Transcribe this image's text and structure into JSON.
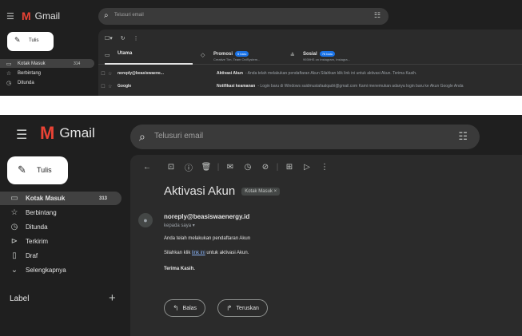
{
  "app": {
    "name": "Gmail"
  },
  "search": {
    "placeholder": "Telusuri email"
  },
  "compose_label": "Tulis",
  "top": {
    "sidebar": [
      {
        "icon": "inbox-icon",
        "label": "Kotak Masuk",
        "count": "314",
        "active": true
      },
      {
        "icon": "star-icon",
        "label": "Berbintang"
      },
      {
        "icon": "clock-icon",
        "label": "Ditunda"
      }
    ],
    "tabs": [
      {
        "icon": "inbox-icon",
        "label": "Utama"
      },
      {
        "icon": "tag-icon",
        "label": "Promosi",
        "badge": "5 baru",
        "subtitle": "Creative Tim, Team OctSystem..."
      },
      {
        "icon": "people-icon",
        "label": "Sosial",
        "badge": "76 baru",
        "subtitle": "9939HS on Instagram, Instagra..."
      }
    ],
    "rows": [
      {
        "sender": "noreply@beasiswaene...",
        "subject": "Aktivasi Akun",
        "snippet": "- Anda telah melakukan pendaftaran Akun Silahkan klik link ini untuk aktivasi Akun. Terima Kasih."
      },
      {
        "sender": "Google",
        "subject": "Notifikasi keamanan",
        "snippet": "- Login baru di Windows saidmustafaalqadri@gmail.com Kami menemukan adanya login baru ke Akun Google Anda"
      }
    ]
  },
  "bottom": {
    "sidebar": [
      {
        "icon": "inbox-icon",
        "label": "Kotak Masuk",
        "count": "313",
        "active": true
      },
      {
        "icon": "star-icon",
        "label": "Berbintang"
      },
      {
        "icon": "clock-icon",
        "label": "Ditunda"
      },
      {
        "icon": "send-icon",
        "label": "Terkirim"
      },
      {
        "icon": "draft-icon",
        "label": "Draf"
      },
      {
        "icon": "chevron-down-icon",
        "label": "Selengkapnya"
      }
    ],
    "label_header": "Label",
    "email": {
      "subject": "Aktivasi Akun",
      "chip": "Kotak Masuk ×",
      "from": "noreply@beasiswaenergy.id",
      "to": "kepada saya ▾",
      "line1": "Anda telah melakukan pendaftaran Akun",
      "line2_pre": "Silahkan klik ",
      "line2_link": "link ini",
      "line2_post": " untuk aktivasi Akun.",
      "closing": "Terima Kasih."
    },
    "reply_label": "Balas",
    "forward_label": "Teruskan"
  }
}
